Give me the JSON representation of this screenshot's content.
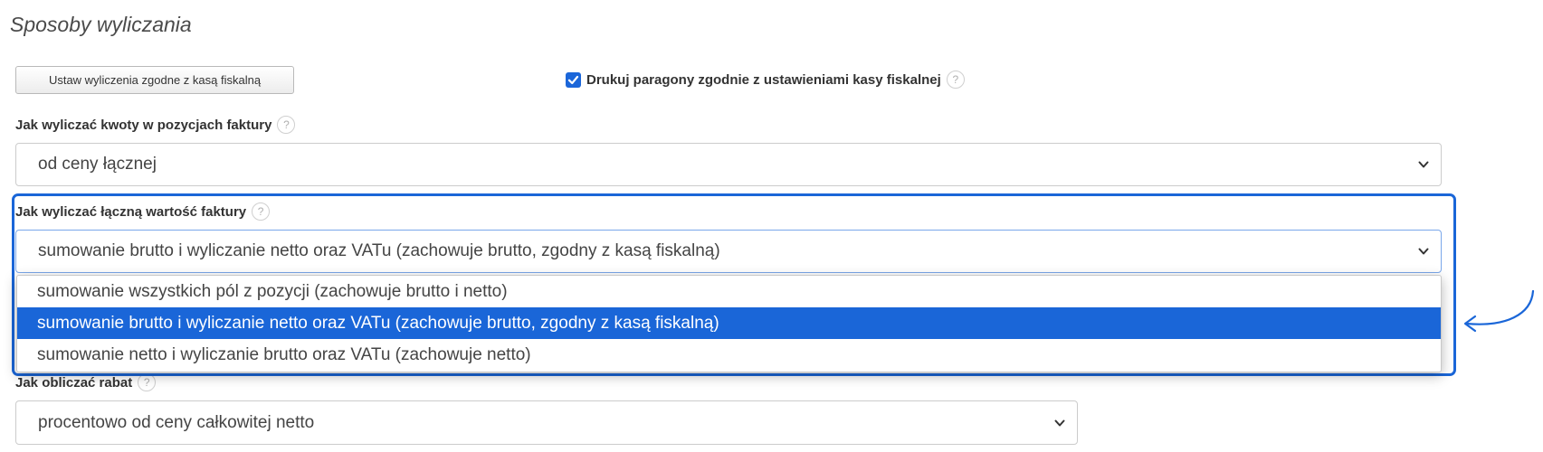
{
  "section": {
    "title": "Sposoby wyliczania"
  },
  "fiscal_button": {
    "label": "Ustaw wyliczenia zgodne z kasą fiskalną"
  },
  "print_receipts": {
    "checked": true,
    "label": "Drukuj paragony zgodnie z ustawieniami kasy fiskalnej",
    "help": "?"
  },
  "item_amounts": {
    "label": "Jak wyliczać kwoty w pozycjach faktury",
    "help": "?",
    "value": "od ceny łącznej"
  },
  "total_value": {
    "label": "Jak wyliczać łączną wartość faktury",
    "help": "?",
    "value": "sumowanie brutto i wyliczanie netto oraz VATu (zachowuje brutto, zgodny z kasą fiskalną)",
    "options": [
      "sumowanie wszystkich pól z pozycji (zachowuje brutto i netto)",
      "sumowanie brutto i wyliczanie netto oraz VATu (zachowuje brutto, zgodny z kasą fiskalną)",
      "sumowanie netto i wyliczanie brutto oraz VATu (zachowuje netto)"
    ],
    "selected_index": 1
  },
  "discount": {
    "label": "Jak obliczać rabat",
    "help": "?",
    "value": "procentowo od ceny całkowitej netto"
  },
  "colors": {
    "accent": "#1a66d8",
    "text": "#333333"
  },
  "icons": {
    "chevron": "chevron-down-icon",
    "help": "help-circle-icon",
    "check": "checkmark-icon",
    "annotation": "curved-arrow-icon"
  }
}
